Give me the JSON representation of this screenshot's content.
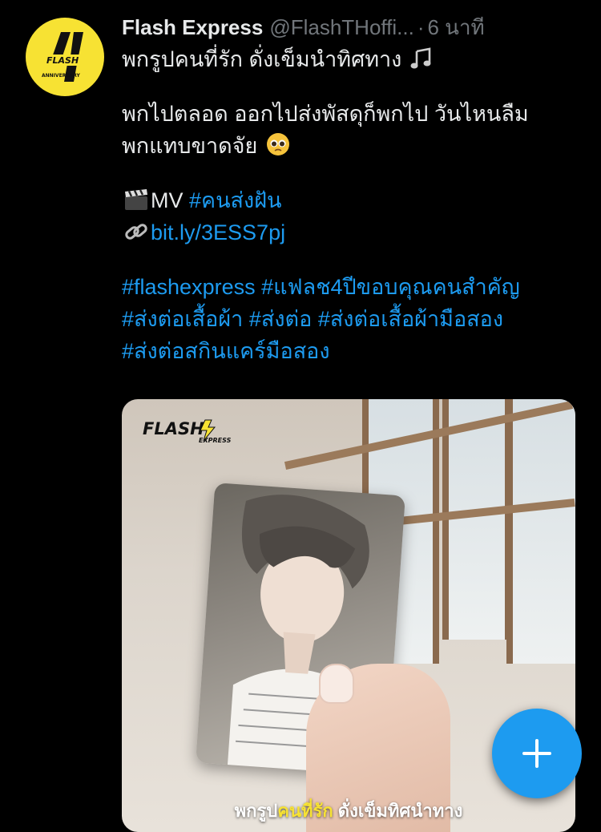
{
  "tweet": {
    "author_name": "Flash Express",
    "author_handle": "@FlashTHoffi...",
    "separator": "·",
    "timestamp": "6 นาที",
    "avatar_text": "ANNIVERSARY",
    "lines": {
      "l1": "พกรูปคนที่รัก ดั่งเข็มนำทิศทาง",
      "l2": "พกไปตลอด ออกไปส่งพัสดุก็พกไป วันไหนลืม",
      "l3": "พกแทบขาดจัย",
      "l4_prefix": "MV",
      "l4_hashtag": "#คนส่งฝัน",
      "l5_link": "bit.ly/3ESS7pj",
      "l6a": "#flashexpress",
      "l6b": "#แฟลช4ปีขอบคุณคนสำคัญ",
      "l7a": "#ส่งต่อเสื้อผ้า",
      "l7b": "#ส่งต่อ",
      "l7c": "#ส่งต่อเสื้อผ้ามือสอง",
      "l8a": "#ส่งต่อสกินแคร์มือสอง"
    },
    "media": {
      "logo_text": "FLASH",
      "logo_sub": "EXPRESS",
      "caption_part1": "พกรูป",
      "caption_highlight": "คนที่รัก",
      "caption_part2": " ดั่งเข็มทิศนำทาง"
    }
  },
  "compose_button": {
    "label": "+"
  },
  "colors": {
    "background": "#000000",
    "text": "#e7e9ea",
    "muted": "#71767b",
    "link": "#1d9bf0",
    "brand_yellow": "#f7e233"
  },
  "icons": [
    "music-note-icon",
    "pleading-face-icon",
    "clapper-board-icon",
    "link-icon",
    "plus-icon"
  ]
}
